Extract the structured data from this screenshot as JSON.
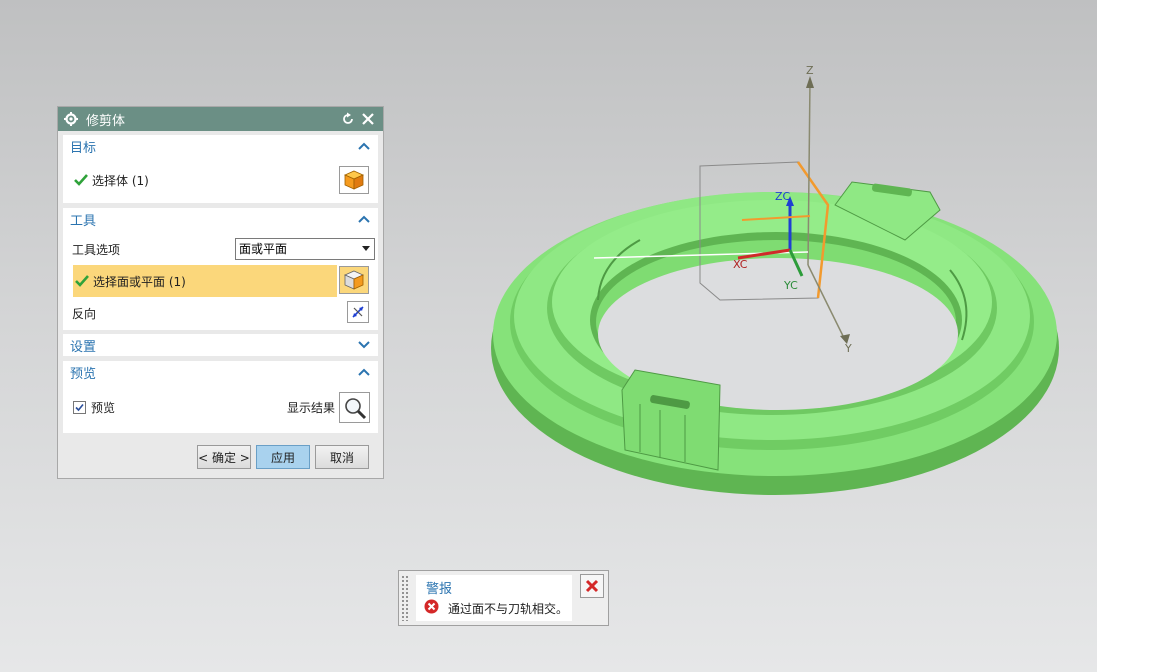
{
  "dialog": {
    "title": "修剪体",
    "target_group": {
      "label": "目标",
      "select_body": "选择体 (1)"
    },
    "tool_group": {
      "label": "工具",
      "tool_option_label": "工具选项",
      "tool_option_value": "面或平面",
      "tool_option_choices": [
        "面或平面"
      ],
      "select_face": "选择面或平面 (1)",
      "reverse_label": "反向"
    },
    "settings_group": {
      "label": "设置"
    },
    "preview_group": {
      "label": "预览",
      "preview_checkbox": "预览",
      "show_result": "显示结果",
      "preview_checked": true
    },
    "buttons": {
      "ok": "< 确定 >",
      "apply": "应用",
      "cancel": "取消"
    }
  },
  "axes": {
    "z": "Z",
    "y": "Y",
    "zc": "ZC",
    "xc": "XC",
    "yc": "YC"
  },
  "alert": {
    "title": "警报",
    "message": "通过面不与刀轨相交。"
  },
  "colors": {
    "part": "#7ee06e",
    "accent": "#2b74b0",
    "titlebar": "#6b8f85",
    "highlight": "#fbd77b"
  },
  "icons": [
    "gear-icon",
    "reset-icon",
    "close-icon",
    "check-icon",
    "solid-body-icon",
    "face-select-icon",
    "reverse-direction-icon",
    "magnifier-icon",
    "error-icon",
    "chevron-up-icon",
    "chevron-down-icon"
  ]
}
